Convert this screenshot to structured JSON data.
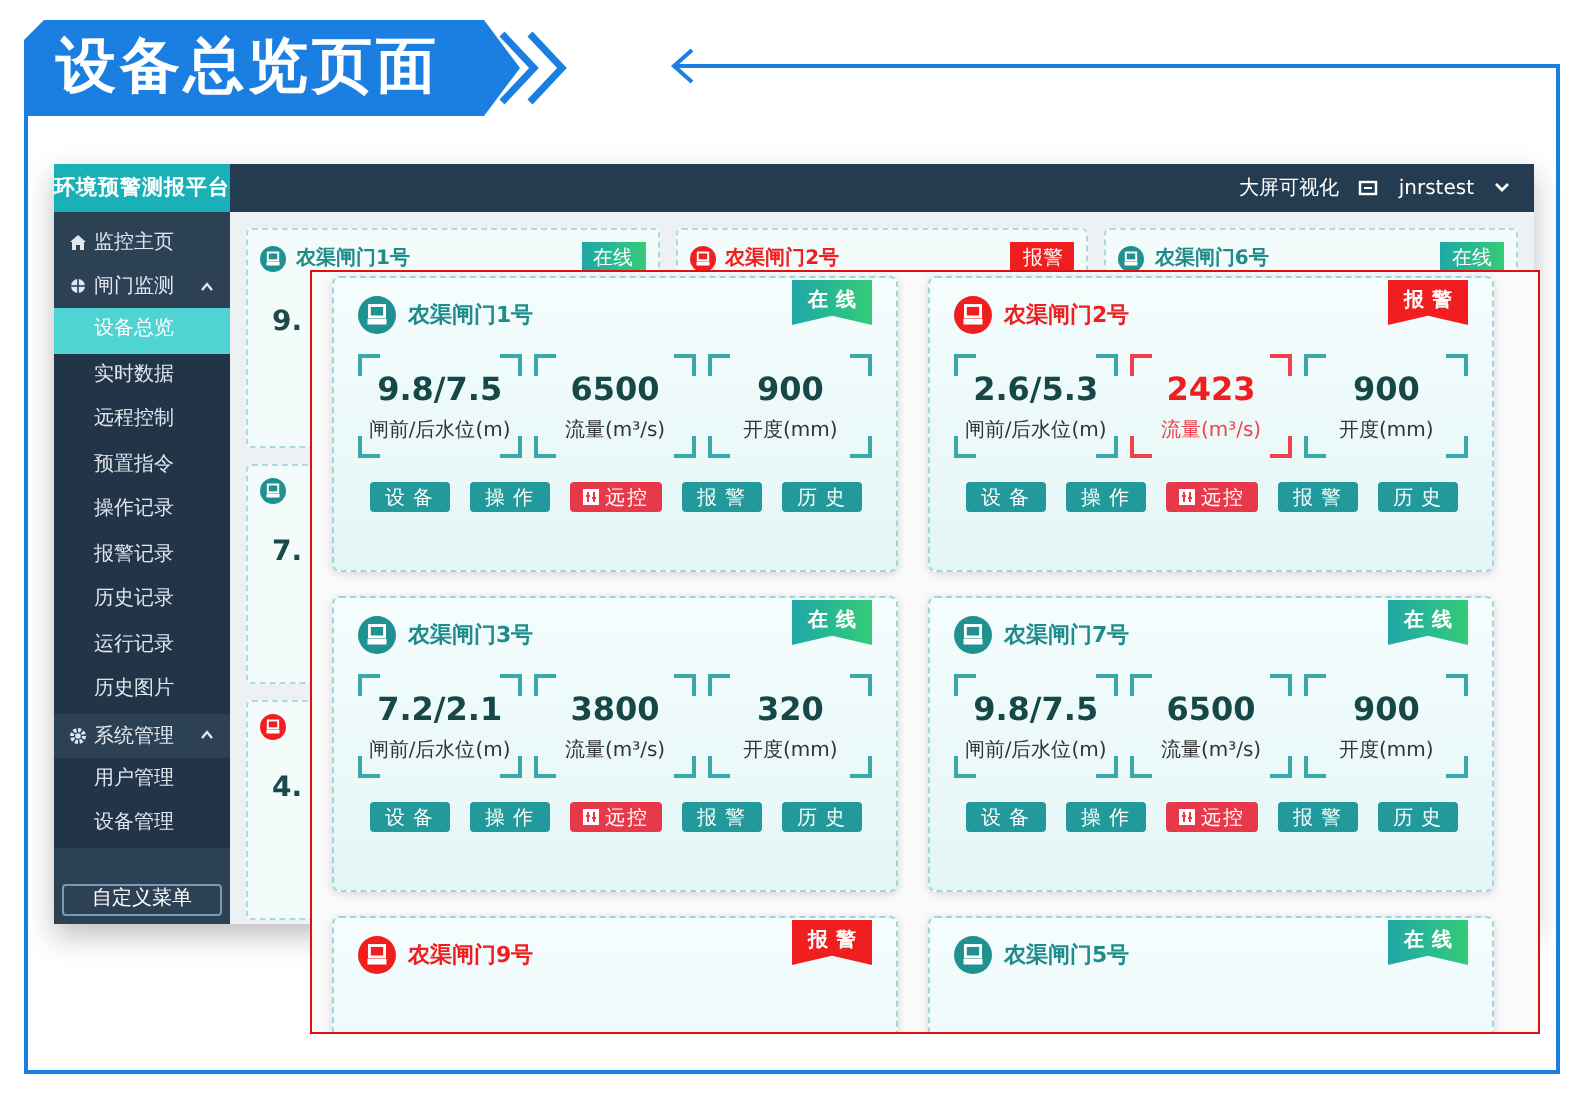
{
  "banner": {
    "title": "设备总览页面"
  },
  "app": {
    "brand": "环境预警测报平台",
    "header_link": "大屏可视化",
    "user": "jnrstest",
    "sidebar": {
      "items": [
        {
          "label": "监控主页"
        },
        {
          "label": "闸门监测",
          "expanded": true,
          "children": [
            {
              "label": "设备总览",
              "selected": true
            },
            {
              "label": "实时数据",
              "selected": false
            },
            {
              "label": "远程控制",
              "selected": false
            },
            {
              "label": "预置指令",
              "selected": false
            },
            {
              "label": "操作记录",
              "selected": false
            },
            {
              "label": "报警记录",
              "selected": false
            },
            {
              "label": "历史记录",
              "selected": false
            },
            {
              "label": "运行记录",
              "selected": false
            },
            {
              "label": "历史图片",
              "selected": false
            }
          ]
        },
        {
          "label": "系统管理",
          "expanded": true,
          "children": [
            {
              "label": "用户管理",
              "selected": false
            },
            {
              "label": "设备管理",
              "selected": false
            }
          ]
        }
      ],
      "footer_button": "自定义菜单"
    },
    "background_cards": [
      {
        "title": "农渠闸门1号",
        "alarm": false,
        "tag": "在线",
        "value": "9."
      },
      {
        "title": "农渠闸门2号",
        "alarm": true,
        "tag": "报警"
      },
      {
        "title": "农渠闸门6号",
        "alarm": false,
        "tag": "在线"
      },
      {
        "alarm": false,
        "value": "7."
      },
      {
        "alarm": true,
        "value": "4."
      }
    ]
  },
  "zoom": {
    "cards": [
      {
        "title": "农渠闸门1号",
        "alarm": false,
        "tag": "在线",
        "metrics": [
          {
            "value": "9.8/7.5",
            "label": "闸前/后水位(m)",
            "alarm": false
          },
          {
            "value": "6500",
            "label": "流量(m³/s)",
            "alarm": false
          },
          {
            "value": "900",
            "label": "开度(mm)",
            "alarm": false
          }
        ],
        "buttons": [
          {
            "label": "设备",
            "kind": "plain"
          },
          {
            "label": "操作",
            "kind": "plain"
          },
          {
            "label": "远控",
            "kind": "remote"
          },
          {
            "label": "报警",
            "kind": "plain"
          },
          {
            "label": "历史",
            "kind": "plain"
          }
        ]
      },
      {
        "title": "农渠闸门2号",
        "alarm": true,
        "tag": "报警",
        "metrics": [
          {
            "value": "2.6/5.3",
            "label": "闸前/后水位(m)",
            "alarm": false
          },
          {
            "value": "2423",
            "label": "流量(m³/s)",
            "alarm": true
          },
          {
            "value": "900",
            "label": "开度(mm)",
            "alarm": false
          }
        ],
        "buttons": [
          {
            "label": "设备",
            "kind": "plain"
          },
          {
            "label": "操作",
            "kind": "plain"
          },
          {
            "label": "远控",
            "kind": "remote"
          },
          {
            "label": "报警",
            "kind": "plain"
          },
          {
            "label": "历史",
            "kind": "plain"
          }
        ]
      },
      {
        "title": "农渠闸门3号",
        "alarm": false,
        "tag": "在线",
        "metrics": [
          {
            "value": "7.2/2.1",
            "label": "闸前/后水位(m)",
            "alarm": false
          },
          {
            "value": "3800",
            "label": "流量(m³/s)",
            "alarm": false
          },
          {
            "value": "320",
            "label": "开度(mm)",
            "alarm": false
          }
        ],
        "buttons": [
          {
            "label": "设备",
            "kind": "plain"
          },
          {
            "label": "操作",
            "kind": "plain"
          },
          {
            "label": "远控",
            "kind": "remote"
          },
          {
            "label": "报警",
            "kind": "plain"
          },
          {
            "label": "历史",
            "kind": "plain"
          }
        ]
      },
      {
        "title": "农渠闸门7号",
        "alarm": false,
        "tag": "在线",
        "metrics": [
          {
            "value": "9.8/7.5",
            "label": "闸前/后水位(m)",
            "alarm": false
          },
          {
            "value": "6500",
            "label": "流量(m³/s)",
            "alarm": false
          },
          {
            "value": "900",
            "label": "开度(mm)",
            "alarm": false
          }
        ],
        "buttons": [
          {
            "label": "设备",
            "kind": "plain"
          },
          {
            "label": "操作",
            "kind": "plain"
          },
          {
            "label": "远控",
            "kind": "remote"
          },
          {
            "label": "报警",
            "kind": "plain"
          },
          {
            "label": "历史",
            "kind": "plain"
          }
        ]
      },
      {
        "title": "农渠闸门9号",
        "alarm": true,
        "tag": "报警"
      },
      {
        "title": "农渠闸门5号",
        "alarm": false,
        "tag": "在线"
      }
    ]
  }
}
